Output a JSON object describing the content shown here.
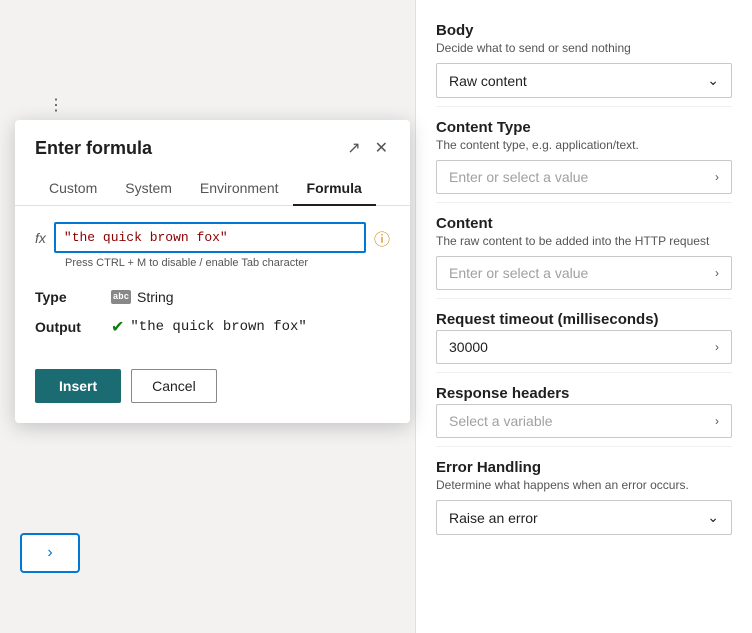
{
  "modal": {
    "title": "Enter formula",
    "tabs": [
      {
        "id": "custom",
        "label": "Custom"
      },
      {
        "id": "system",
        "label": "System"
      },
      {
        "id": "environment",
        "label": "Environment"
      },
      {
        "id": "formula",
        "label": "Formula"
      }
    ],
    "active_tab": "formula",
    "fx_label": "fx",
    "formula_value": "\"the quick brown fox\"",
    "formula_hint": "Press CTRL + M to disable / enable Tab character",
    "type_label": "Type",
    "type_value": "String",
    "output_label": "Output",
    "output_value": "\"the quick brown fox\"",
    "insert_button": "Insert",
    "cancel_button": "Cancel"
  },
  "right_panel": {
    "body": {
      "title": "Body",
      "subtitle": "Decide what to send or send nothing",
      "dropdown_value": "Raw content"
    },
    "content_type": {
      "title": "Content Type",
      "subtitle": "The content type, e.g. application/text.",
      "placeholder": "Enter or select a value"
    },
    "content": {
      "title": "Content",
      "subtitle": "The raw content to be added into the HTTP request",
      "placeholder": "Enter or select a value"
    },
    "request_timeout": {
      "title": "Request timeout (milliseconds)",
      "value": "30000"
    },
    "response_headers": {
      "title": "Response headers",
      "placeholder": "Select a variable"
    },
    "error_handling": {
      "title": "Error Handling",
      "subtitle": "Determine what happens when an error occurs.",
      "dropdown_value": "Raise an error"
    }
  },
  "icons": {
    "expand": "↗",
    "close": "✕",
    "chevron_down": "⌄",
    "chevron_right": "›",
    "info": "ⓘ",
    "check": "✔",
    "string_type": "abc"
  }
}
